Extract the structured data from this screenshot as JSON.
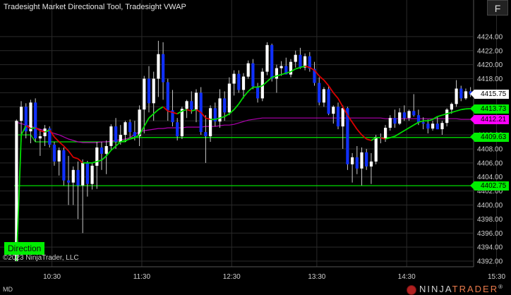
{
  "window": {
    "title": "Tradesight Market Directional Tool, Tradesight VWAP",
    "f_button": "F",
    "copyright": "©2023 NinjaTrader, LLC",
    "status_left": "MD",
    "logo_part1": "NINJA",
    "logo_part2": "TRADER",
    "logo_reg": "®"
  },
  "indicator": {
    "direction_label": "Direction"
  },
  "colors": {
    "bull": "#ffffff",
    "bear": "#1030ff",
    "wick": "#c8c8c8",
    "direction_green": "#00dd00",
    "direction_red": "#dd0000",
    "vwap": "#b000b0",
    "level_line": "#00dd00",
    "grid": "#2a2a2a",
    "tag_current": "#ffffff",
    "tag_green": "#00ee00",
    "tag_magenta": "#ff00ff"
  },
  "price_tags": [
    {
      "value": "4415.75",
      "kind": "current"
    },
    {
      "value": "4413.73",
      "kind": "green"
    },
    {
      "value": "4412.21",
      "kind": "magenta"
    },
    {
      "value": "4409.63",
      "kind": "green"
    },
    {
      "value": "4402.75",
      "kind": "green"
    }
  ],
  "chart_data": {
    "type": "candlestick",
    "instrument": "",
    "y_axis": {
      "ticks": [
        "4424.00",
        "4422.00",
        "4420.00",
        "4418.00",
        "4416.00",
        "4414.00",
        "4412.00",
        "4410.00",
        "4408.00",
        "4406.00",
        "4404.00",
        "4402.00",
        "4400.00",
        "4398.00",
        "4396.00",
        "4394.00",
        "4392.00"
      ],
      "range": [
        4391.2,
        4426.2
      ]
    },
    "x_axis": {
      "ticks": [
        "10:30",
        "11:30",
        "12:30",
        "13:30",
        "14:30",
        "15:30"
      ]
    },
    "levels": [
      4409.63,
      4402.75
    ],
    "ohlc": [
      [
        4392.0,
        4412.2,
        4392.0,
        4412.0
      ],
      [
        4412.0,
        4414.8,
        4409.0,
        4414.0
      ],
      [
        4414.0,
        4414.5,
        4409.5,
        4410.5
      ],
      [
        4410.5,
        4415.0,
        4408.8,
        4414.6
      ],
      [
        4414.6,
        4415.2,
        4409.0,
        4409.5
      ],
      [
        4409.5,
        4410.8,
        4407.0,
        4409.8
      ],
      [
        4409.8,
        4411.4,
        4408.4,
        4410.9
      ],
      [
        4410.9,
        4411.2,
        4408.2,
        4408.6
      ],
      [
        4408.6,
        4409.0,
        4405.6,
        4406.2
      ],
      [
        4406.2,
        4408.2,
        4404.2,
        4407.8
      ],
      [
        4407.8,
        4408.2,
        4402.8,
        4403.5
      ],
      [
        4403.5,
        4407.0,
        4400.0,
        4403.2
      ],
      [
        4403.2,
        4405.5,
        4400.0,
        4405.0
      ],
      [
        4405.0,
        4406.2,
        4398.0,
        4402.8
      ],
      [
        4402.8,
        4406.5,
        4396.0,
        4406.0
      ],
      [
        4406.0,
        4406.3,
        4401.2,
        4403.0
      ],
      [
        4403.0,
        4406.0,
        4402.2,
        4405.6
      ],
      [
        4405.6,
        4409.0,
        4402.3,
        4408.2
      ],
      [
        4408.2,
        4409.0,
        4405.0,
        4407.3
      ],
      [
        4407.3,
        4409.2,
        4404.4,
        4408.4
      ],
      [
        4408.4,
        4411.5,
        4407.9,
        4411.2
      ],
      [
        4411.2,
        4412.4,
        4408.0,
        4409.0
      ],
      [
        4409.0,
        4411.4,
        4408.6,
        4410.0
      ],
      [
        4410.0,
        4412.0,
        4409.0,
        4411.8
      ],
      [
        4411.8,
        4412.2,
        4409.6,
        4410.4
      ],
      [
        4410.4,
        4412.0,
        4409.2,
        4409.8
      ],
      [
        4409.8,
        4414.2,
        4408.4,
        4413.6
      ],
      [
        4413.6,
        4418.4,
        4410.2,
        4418.0
      ],
      [
        4418.0,
        4419.8,
        4413.2,
        4414.5
      ],
      [
        4414.5,
        4419.0,
        4412.0,
        4418.0
      ],
      [
        4418.0,
        4423.4,
        4415.4,
        4421.5
      ],
      [
        4421.5,
        4423.2,
        4415.0,
        4417.5
      ],
      [
        4417.5,
        4418.0,
        4412.0,
        4413.5
      ],
      [
        4413.5,
        4416.4,
        4411.2,
        4411.8
      ],
      [
        4411.8,
        4412.4,
        4409.2,
        4409.8
      ],
      [
        4409.8,
        4414.0,
        4409.4,
        4413.7
      ],
      [
        4413.7,
        4415.0,
        4412.4,
        4414.8
      ],
      [
        4414.8,
        4416.2,
        4413.0,
        4413.6
      ],
      [
        4413.6,
        4416.5,
        4411.8,
        4416.0
      ],
      [
        4416.0,
        4416.8,
        4410.0,
        4410.4
      ],
      [
        4410.4,
        4412.8,
        4406.0,
        4409.8
      ],
      [
        4409.8,
        4414.2,
        4409.0,
        4413.8
      ],
      [
        4413.8,
        4414.6,
        4411.2,
        4411.9
      ],
      [
        4411.9,
        4416.5,
        4411.0,
        4415.2
      ],
      [
        4415.2,
        4416.2,
        4412.0,
        4413.2
      ],
      [
        4413.2,
        4418.2,
        4412.8,
        4417.3
      ],
      [
        4417.3,
        4419.2,
        4415.6,
        4418.7
      ],
      [
        4418.7,
        4419.2,
        4416.0,
        4416.4
      ],
      [
        4416.4,
        4418.8,
        4415.2,
        4418.3
      ],
      [
        4418.3,
        4420.6,
        4418.0,
        4420.2
      ],
      [
        4420.2,
        4420.8,
        4416.5,
        4416.9
      ],
      [
        4416.9,
        4417.4,
        4414.6,
        4415.2
      ],
      [
        4415.2,
        4419.5,
        4414.8,
        4419.0
      ],
      [
        4419.0,
        4423.2,
        4418.5,
        4422.8
      ],
      [
        4422.8,
        4423.0,
        4417.6,
        4418.0
      ],
      [
        4418.0,
        4420.0,
        4416.0,
        4419.5
      ],
      [
        4419.5,
        4420.5,
        4418.4,
        4419.8
      ],
      [
        4419.8,
        4421.0,
        4418.6,
        4418.6
      ],
      [
        4418.6,
        4420.8,
        4418.2,
        4420.4
      ],
      [
        4420.4,
        4422.0,
        4419.6,
        4421.4
      ],
      [
        4421.4,
        4422.4,
        4419.4,
        4419.6
      ],
      [
        4419.6,
        4421.6,
        4419.2,
        4421.2
      ],
      [
        4421.2,
        4421.8,
        4419.0,
        4419.4
      ],
      [
        4419.4,
        4420.4,
        4417.0,
        4417.4
      ],
      [
        4417.4,
        4418.2,
        4414.2,
        4414.6
      ],
      [
        4414.6,
        4416.8,
        4414.0,
        4416.5
      ],
      [
        4416.5,
        4417.0,
        4412.8,
        4413.0
      ],
      [
        4413.0,
        4414.2,
        4411.6,
        4414.0
      ],
      [
        4414.0,
        4414.6,
        4410.8,
        4411.2
      ],
      [
        4411.2,
        4414.2,
        4408.0,
        4413.8
      ],
      [
        4413.8,
        4414.0,
        4405.0,
        4405.8
      ],
      [
        4405.8,
        4407.4,
        4403.2,
        4406.8
      ],
      [
        4406.8,
        4408.4,
        4404.4,
        4405.2
      ],
      [
        4405.2,
        4408.2,
        4402.8,
        4407.5
      ],
      [
        4407.5,
        4408.0,
        4405.0,
        4405.5
      ],
      [
        4405.5,
        4407.4,
        4403.0,
        4406.2
      ],
      [
        4406.2,
        4410.0,
        4405.8,
        4409.7
      ],
      [
        4409.7,
        4410.2,
        4408.8,
        4409.5
      ],
      [
        4409.5,
        4411.4,
        4409.0,
        4411.0
      ],
      [
        4411.0,
        4412.8,
        4410.6,
        4412.4
      ],
      [
        4412.4,
        4413.6,
        4411.0,
        4411.6
      ],
      [
        4411.6,
        4413.8,
        4411.4,
        4413.2
      ],
      [
        4413.2,
        4414.2,
        4412.0,
        4412.4
      ],
      [
        4412.4,
        4413.6,
        4412.0,
        4413.4
      ],
      [
        4413.4,
        4415.8,
        4412.6,
        4412.8
      ],
      [
        4412.8,
        4413.6,
        4411.4,
        4411.8
      ],
      [
        4411.8,
        4412.5,
        4410.8,
        4411.6
      ],
      [
        4411.6,
        4412.2,
        4410.2,
        4410.9
      ],
      [
        4410.9,
        4412.0,
        4410.6,
        4411.6
      ],
      [
        4411.6,
        4412.6,
        4410.8,
        4410.8
      ],
      [
        4410.8,
        4412.0,
        4410.0,
        4411.7
      ],
      [
        4411.7,
        4413.8,
        4411.2,
        4413.6
      ],
      [
        4413.6,
        4414.6,
        4413.0,
        4414.4
      ],
      [
        4414.4,
        4417.8,
        4414.0,
        4416.6
      ],
      [
        4416.6,
        4417.0,
        4414.8,
        4415.2
      ],
      [
        4415.2,
        4416.6,
        4415.0,
        4416.2
      ],
      [
        4416.2,
        4416.8,
        4415.4,
        4415.75
      ]
    ],
    "direction": [
      4392.0,
      4410.0,
      4411.3,
      4410.9,
      4411.0,
      4410.6,
      4410.4,
      4410.7,
      4409.7,
      4409.0,
      4408.4,
      4407.7,
      4406.8,
      4406.6,
      4406.0,
      4406.0,
      4406.0,
      4406.2,
      4406.4,
      4407.0,
      4407.8,
      4408.4,
      4409.0,
      4409.2,
      4409.4,
      4409.6,
      4410.0,
      4411.2,
      4412.4,
      4413.0,
      4413.6,
      4414.0,
      4413.4,
      4413.2,
      4413.0,
      4413.4,
      4413.6,
      4413.4,
      4413.6,
      4413.2,
      4412.4,
      4412.2,
      4412.2,
      4412.4,
      4412.6,
      4413.0,
      4413.6,
      4414.4,
      4415.4,
      4416.2,
      4416.8,
      4416.8,
      4417.0,
      4417.6,
      4418.2,
      4418.4,
      4418.6,
      4418.8,
      4419.0,
      4419.4,
      4419.6,
      4419.8,
      4419.6,
      4419.2,
      4418.4,
      4417.8,
      4417.0,
      4416.0,
      4415.2,
      4414.0,
      4412.8,
      4411.8,
      4410.8,
      4410.0,
      4409.4,
      4409.2,
      4409.6,
      4409.6,
      4409.4,
      4409.6,
      4409.8,
      4410.2,
      4410.6,
      4411.0,
      4411.4,
      4411.8,
      4412.0,
      4412.0,
      4412.2,
      4412.6,
      4412.8,
      4413.0,
      4413.2,
      4413.4,
      4413.6,
      4413.7,
      4413.73
    ],
    "vwap": [
      4411.8,
      4411.6,
      4411.4,
      4411.2,
      4411.0,
      4410.8,
      4410.6,
      4410.4,
      4410.2,
      4410.0,
      4409.7,
      4409.4,
      4409.2,
      4409.0,
      4408.9,
      4408.9,
      4408.9,
      4408.9,
      4409.0,
      4409.0,
      4409.1,
      4409.2,
      4409.3,
      4409.4,
      4409.6,
      4410.1,
      4410.4,
      4410.6,
      4410.7,
      4410.8,
      4410.9,
      4410.9,
      4411.0,
      4411.0,
      4411.0,
      4411.0,
      4411.1,
      4411.1,
      4411.1,
      4411.1,
      4411.2,
      4411.2,
      4411.2,
      4411.3,
      4411.4,
      4411.4,
      4411.5,
      4411.7,
      4411.9,
      4412.1,
      4412.2,
      4412.3,
      4412.4,
      4412.4,
      4412.4,
      4412.4,
      4412.4,
      4412.4,
      4412.4,
      4412.4,
      4412.4,
      4412.4,
      4412.4,
      4412.4,
      4412.4,
      4412.4,
      4412.4,
      4412.4,
      4412.4,
      4412.4,
      4412.4,
      4412.4,
      4412.4,
      4412.4,
      4412.4,
      4412.4,
      4412.4,
      4412.4,
      4412.3,
      4412.3,
      4412.3,
      4412.3,
      4412.3,
      4412.3,
      4412.3,
      4412.3,
      4412.3,
      4412.3,
      4412.3,
      4412.3,
      4412.3,
      4412.3,
      4412.3,
      4412.3,
      4412.21,
      4412.21,
      4412.21
    ],
    "step_line": [
      4410.0,
      4410.0,
      4410.0,
      4410.0,
      4409.0,
      4409.0,
      4409.0,
      4409.0,
      4409.0,
      4409.0,
      4409.0,
      4409.0,
      4409.0,
      4409.0,
      4409.0,
      4409.0,
      4409.0,
      4409.0,
      4409.0,
      4409.0,
      4409.0,
      4409.0,
      4409.0,
      4409.0,
      4409.63,
      4409.63,
      4409.63,
      4409.63,
      4409.63,
      4409.63,
      4409.63,
      4409.63,
      4409.63,
      4409.63,
      4409.63,
      4409.63,
      4409.63,
      4409.63,
      4409.63,
      4409.63,
      4409.63,
      4409.63,
      4409.63,
      4409.63,
      4409.63,
      4409.63,
      4409.63,
      4409.63,
      4409.63,
      4409.63,
      4409.63,
      4409.63,
      4409.63,
      4409.63,
      4409.63,
      4409.63,
      4409.63,
      4409.63,
      4409.63,
      4409.63,
      4409.63,
      4409.63,
      4409.63,
      4409.63,
      4409.63,
      4409.63,
      4409.63,
      4409.63,
      4409.63,
      4409.63,
      4409.63,
      4409.63,
      4409.63,
      4409.63,
      4409.63,
      4409.63,
      4409.63,
      4409.63,
      4409.63,
      4409.63,
      4409.63,
      4409.63,
      4409.63,
      4409.63,
      4409.63,
      4409.63,
      4409.63,
      4409.63,
      4409.63,
      4409.63,
      4409.63,
      4409.63,
      4409.63,
      4409.63,
      4409.63,
      4409.63,
      4409.63
    ]
  }
}
